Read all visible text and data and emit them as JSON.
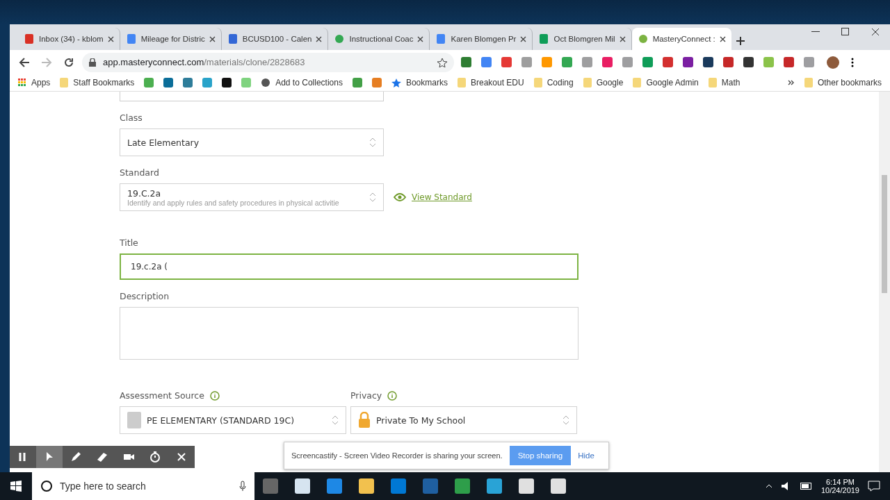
{
  "browser": {
    "tabs": [
      {
        "title": "Inbox (34) - kblom",
        "kind": "gmail",
        "selected": false
      },
      {
        "title": "Mileage for Distric",
        "kind": "docs",
        "selected": false
      },
      {
        "title": "BCUSD100 - Calen",
        "kind": "calendar",
        "selected": false
      },
      {
        "title": "Instructional Coac",
        "kind": "circle",
        "selected": false
      },
      {
        "title": "Karen Blomgen Pr",
        "kind": "docs",
        "selected": false
      },
      {
        "title": "Oct Blomgren Mil",
        "kind": "sheets",
        "selected": false
      },
      {
        "title": "MasteryConnect :",
        "kind": "mastery",
        "selected": true
      }
    ],
    "url": {
      "host": "app.masteryconnect.com",
      "path": "/materials/clone/2828683"
    },
    "extensions": [
      {
        "color": "#2e7d32"
      },
      {
        "color": "#4285f4"
      },
      {
        "color": "#e53935"
      },
      {
        "color": "#9e9e9e"
      },
      {
        "color": "#ff9800"
      },
      {
        "color": "#34a853"
      },
      {
        "color": "#9e9e9f"
      },
      {
        "color": "#e91e63"
      },
      {
        "color": "#9e9ea0"
      },
      {
        "color": "#0f9d58"
      },
      {
        "color": "#d32f2f"
      },
      {
        "color": "#7b1fa2"
      },
      {
        "color": "#1a3a5c"
      },
      {
        "color": "#c62828"
      },
      {
        "color": "#333333"
      },
      {
        "color": "#8bc34a"
      },
      {
        "color": "#c62829"
      },
      {
        "color": "#9e9ea1"
      }
    ],
    "bookmarks": [
      {
        "kind": "apps",
        "label": "Apps"
      },
      {
        "kind": "folder",
        "label": "Staff Bookmarks"
      },
      {
        "kind": "icon",
        "color": "#4caf50"
      },
      {
        "kind": "icon",
        "color": "#0b6e99"
      },
      {
        "kind": "icon",
        "color": "#2e7d9a"
      },
      {
        "kind": "icon",
        "color": "#29a3c9"
      },
      {
        "kind": "icon",
        "color": "#111111"
      },
      {
        "kind": "icon",
        "color": "#7fd37f"
      },
      {
        "kind": "globe",
        "label": "Add to Collections"
      },
      {
        "kind": "icon",
        "color": "#43a047"
      },
      {
        "kind": "icon",
        "color": "#e67e22"
      },
      {
        "kind": "star",
        "label": "Bookmarks"
      },
      {
        "kind": "folder",
        "label": "Breakout EDU"
      },
      {
        "kind": "folder",
        "label": "Coding"
      },
      {
        "kind": "folder",
        "label": "Google"
      },
      {
        "kind": "folder",
        "label": "Google Admin"
      },
      {
        "kind": "folder",
        "label": "Math"
      }
    ],
    "other_bookmarks": "Other bookmarks"
  },
  "form": {
    "class": {
      "label": "Class",
      "value": "Late Elementary"
    },
    "standard": {
      "label": "Standard",
      "code": "19.C.2a",
      "description": "Identify and apply rules and safety procedures in physical activitie",
      "link": "View Standard"
    },
    "title": {
      "label": "Title",
      "value": "19.c.2a (",
      "focused": true
    },
    "description": {
      "label": "Description"
    },
    "assessment_source": {
      "label": "Assessment Source",
      "value": "PE ELEMENTARY (STANDARD 19C)"
    },
    "privacy": {
      "label": "Privacy",
      "value": "Private To My School"
    }
  },
  "recorder_toolbar": [
    {
      "kind": "pause",
      "selected": false
    },
    {
      "kind": "pointer",
      "selected": true
    },
    {
      "kind": "pen",
      "selected": false
    },
    {
      "kind": "eraser",
      "selected": false
    },
    {
      "kind": "camera",
      "selected": false
    },
    {
      "kind": "timer",
      "selected": false
    },
    {
      "kind": "close",
      "selected": false
    }
  ],
  "sharing_bar": {
    "message": "Screencastify - Screen Video Recorder is sharing your screen.",
    "stop_button": "Stop sharing",
    "hide_link": "Hide"
  },
  "taskbar": {
    "search_placeholder": "Type here to search",
    "time": "6:14 PM",
    "date": "10/24/2019"
  }
}
